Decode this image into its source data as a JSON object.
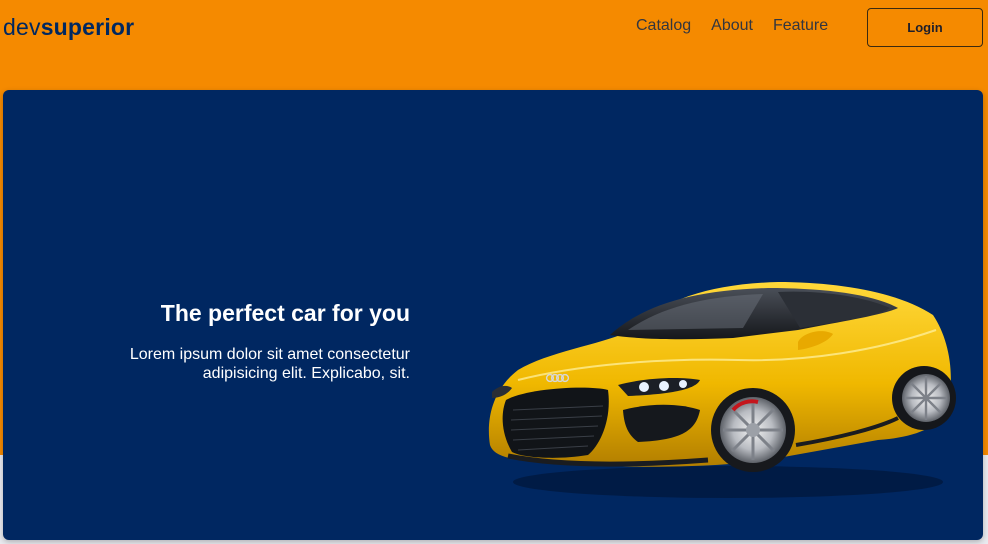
{
  "header": {
    "logo_light": "dev",
    "logo_bold": "superior",
    "nav": [
      {
        "label": "Catalog"
      },
      {
        "label": "About"
      },
      {
        "label": "Feature"
      }
    ],
    "login_label": "Login"
  },
  "hero": {
    "title": "The perfect car for you",
    "subtitle": "Lorem ipsum dolor sit amet consectetur adipisicing elit. Explicabo, sit.",
    "image_icon": "yellow-sports-car"
  },
  "colors": {
    "header_bg": "#f58a00",
    "hero_bg": "#002761",
    "logo": "#002860",
    "page_bg": "#e9eaef",
    "car_yellow": "#f2c000"
  }
}
